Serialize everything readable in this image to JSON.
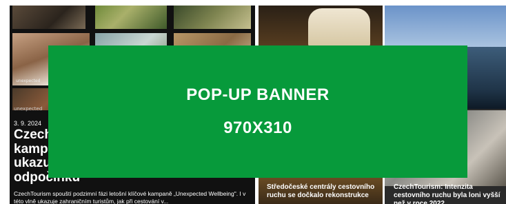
{
  "featured": {
    "thumb_tags": [
      "unexpected",
      "unexpected"
    ],
    "label": "unexpected",
    "date": "3. 9. 2024",
    "title_lines": [
      "Czech",
      "kampa",
      "ukazu",
      "odpočinku"
    ],
    "excerpt": "CzechTourism spouští podzimní fázi letošní klíčové kampaně „Unexpected Wellbeing\". I v této vlně ukazuje zahraničním turistům, jak při cestování v..."
  },
  "middle": {
    "title": "Středočeské centrály cestovního ruchu se dočkalo rekonstrukce"
  },
  "right": {
    "title": "CzechTourism: Intenzita cestovního ruchu byla loni vyšší než v roce 2022"
  },
  "popup": {
    "line1": "POP-UP BANNER",
    "line2": "970X310",
    "color": "#079a3b"
  }
}
